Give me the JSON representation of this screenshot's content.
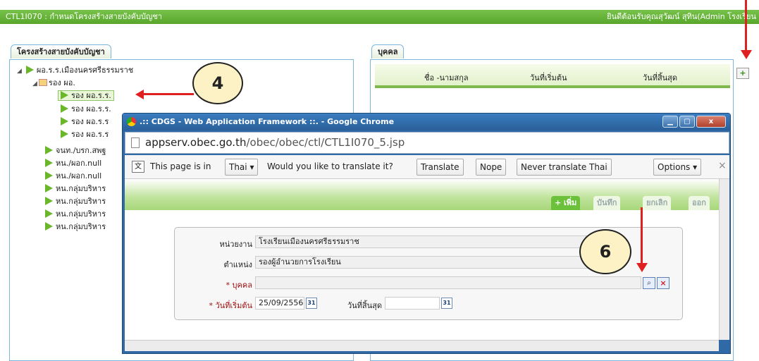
{
  "app": {
    "title": "CTL1I070 : กำหนดโครงสร้างสายบังคับบัญชา",
    "welcome": "ยินดีต้อนรับคุณสุวัฒน์ สุทิน(Admin โรงเรียน"
  },
  "left_panel": {
    "tab": "โครงสร้างสายบังคับบัญชา",
    "tree": [
      "ผอ.ร.ร.เมืองนครศรีธรรมราช",
      "รอง ผอ.",
      "รอง ผอ.ร.ร.",
      "รอง ผอ.ร.ร.",
      "รอง ผอ.ร.ร",
      "รอง ผอ.ร.ร",
      "จนท./บรก.สพฐ",
      "หน./ผอก.null",
      "หน./ผอก.null",
      "หน.กลุ่มบริหาร",
      "หน.กลุ่มบริหาร",
      "หน.กลุ่มบริหาร",
      "หน.กลุ่มบริหาร"
    ]
  },
  "right_panel": {
    "tab": "บุคคล",
    "columns": [
      "ชื่อ -นามสกุล",
      "วันที่เริ่มต้น",
      "วันที่สิ้นสุด"
    ]
  },
  "dialog": {
    "title": ".:: CDGS - Web Application Framework ::. - Google Chrome",
    "url_domain": "appserv.obec.go.th",
    "url_path": "/obec/obec/ctl/CTL1I070_5.jsp",
    "translate": {
      "prefix": "This page is in",
      "language": "Thai",
      "question": "Would you like to translate it?",
      "translate_btn": "Translate",
      "nope_btn": "Nope",
      "never_btn": "Never translate Thai",
      "options_btn": "Options",
      "close_glyph": "×"
    },
    "actions": {
      "add": "+ เพิ่ม",
      "save": "บันทึก",
      "cancel": "ยกเลิก",
      "exit": "ออก"
    },
    "form": {
      "unit_label": "หน่วยงาน",
      "unit_value": "โรงเรียนเมืองนครศรีธรรมราช",
      "position_label": "ตำแหน่ง",
      "position_value": "รองผู้อำนวยการโรงเรียน",
      "person_label": "บุคคล",
      "start_label": "วันที่เริ่มต้น",
      "start_value": "25/09/2556",
      "end_label": "วันที่สิ้นสุด",
      "end_value": "",
      "required_mark": "*",
      "cal_glyph": "31"
    }
  },
  "callouts": {
    "four": "4",
    "six": "6"
  },
  "colors": {
    "topbar": "#58a62c",
    "accent_green": "#6cc13b",
    "dialog_frame": "#2f6aa7",
    "arrow_red": "#e02020"
  }
}
